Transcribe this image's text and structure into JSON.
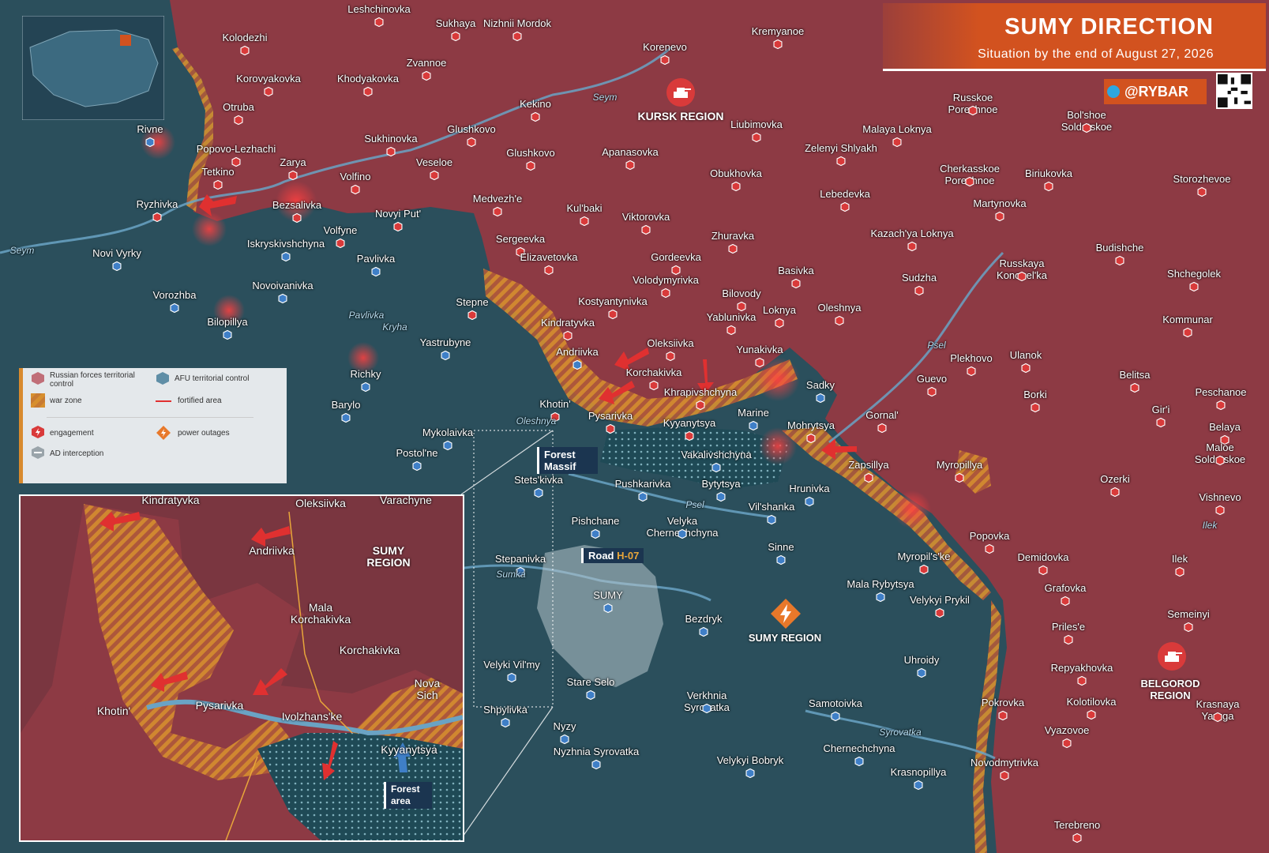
{
  "header": {
    "title": "SUMY DIRECTION",
    "subtitle": "Situation by the end of August 27, 2026",
    "brand": "@RYBAR"
  },
  "colors": {
    "russian": "#8d3a44",
    "afu": "#2b4f5c",
    "warzone": "#d7902e",
    "accent": "#d2521f",
    "engagement": "#d93a3a"
  },
  "legend": {
    "russian": "Russian forces territorial control",
    "afu": "AFU territorial control",
    "warzone": "war zone",
    "fortified": "fortified area",
    "engagement": "engagement",
    "power": "power outages",
    "ad": "AD interception"
  },
  "regions": {
    "kursk": "KURSK REGION",
    "sumy_main": "SUMY REGION",
    "belgorod": "BELGOROD REGION",
    "sumy_inset": "SUMY REGION"
  },
  "chips": {
    "forest_massif": "Forest Massif",
    "road_prefix": "Road ",
    "road_code": "H-07",
    "forest_area": "Forest area"
  },
  "rivers": [
    "Seym",
    "Seym",
    "Psel",
    "Psel",
    "Sumka",
    "Oleshnya",
    "Pavlivka",
    "Kryha",
    "Syrovatka",
    "Ilek",
    "Oleshnya"
  ],
  "places": [
    "Leshchinovka",
    "Sukhaya",
    "Nizhnii Mordok",
    "Kremyanoe",
    "Korenevo",
    "Kolodezhi",
    "Zvannoe",
    "Korovyakovka",
    "Khodyakovka",
    "Kekino",
    "Otruba",
    "Rivne",
    "Sukhinovka",
    "Glushkovo",
    "Veseloe",
    "Glushkovo",
    "Apanasovka",
    "Liubimovka",
    "Zelenyi Shlyakh",
    "Malaya Loknya",
    "Russkoe Porechnoe",
    "Bol'shoe Soldatskoe",
    "Popovo-Lezhachi",
    "Tetkino",
    "Zarya",
    "Volfino",
    "Medvezh'e",
    "Kul'baki",
    "Viktorovka",
    "Obukhovka",
    "Lebedevka",
    "Cherkasskoe Porechnoe",
    "Biriukovka",
    "Storozhevoe",
    "Martynovka",
    "Ryzhivka",
    "Bezsalivka",
    "Novyi Put'",
    "Volfyne",
    "Sergeevka",
    "Zhuravka",
    "Kazach'ya Loknya",
    "Budishche",
    "Iskryskivshchyna",
    "Novi Vyrky",
    "Pavlivka",
    "Elizavetovka",
    "Gordeevka",
    "Russkaya Konopel'ka",
    "Novoivanivka",
    "Volodymyrivka",
    "Basivka",
    "Sudzha",
    "Shchegolek",
    "Vorozhba",
    "Stepne",
    "Kostyantynivka",
    "Bilovody",
    "Yablunivka",
    "Loknya",
    "Oleshnya",
    "Bilopillya",
    "Kindratyvka",
    "Kommunar",
    "Yastrubyne",
    "Oleksiivka",
    "Andriivka",
    "Yunakivka",
    "Plekhovo",
    "Ulanok",
    "Richky",
    "Korchakivka",
    "Khrapivshchyna",
    "Sadky",
    "Guevo",
    "Borki",
    "Belitsa",
    "Peschanoe",
    "Barylo",
    "Khotin'",
    "Pysarivka",
    "Kyyanytsya",
    "Marine",
    "Gornal'",
    "Gir'i",
    "Mohrytsya",
    "Belaya",
    "Mykolaivka",
    "Maloe Soldatskoe",
    "Postol'ne",
    "Vakalivshchyna",
    "Zapsillya",
    "Myropillya",
    "Stets'kivka",
    "Pushkarivka",
    "Bytytsya",
    "Ozerki",
    "Hrunivka",
    "Vishnevo",
    "Velyka Chernechchyna",
    "Vil'shanka",
    "Pishchane",
    "Popovka",
    "Sinne",
    "Stepanivka",
    "Demidovka",
    "Ilek",
    "Myropil's'ke",
    "Mala Rybytsya",
    "Velykyi Prykil",
    "Grafovka",
    "SUMY",
    "Bezdryk",
    "Semeinyi",
    "Priles'e",
    "Velyki Vil'my",
    "Uhroidy",
    "Repyakhovka",
    "Stare Selo",
    "Verkhnia Syrovatka",
    "Samotoivka",
    "Pokrovka",
    "Kolotilovka",
    "Shpylivka",
    "Nyzy",
    "Vyazovoe",
    "Krasnaya Yaruga",
    "Nyzhnia Syrovatka",
    "Velykyi Bobryk",
    "Chernechchyna",
    "Novodmytrivka",
    "Krasnopillya",
    "Terebreno"
  ],
  "inset_places": [
    "Kindratyvka",
    "Oleksiivka",
    "Varachyne",
    "Andriivka",
    "Mala Korchakivka",
    "Korchakivka",
    "Nova Sich",
    "Khotin'",
    "Pysarivka",
    "Ivolzhans'ke",
    "Kyyanytsya"
  ]
}
